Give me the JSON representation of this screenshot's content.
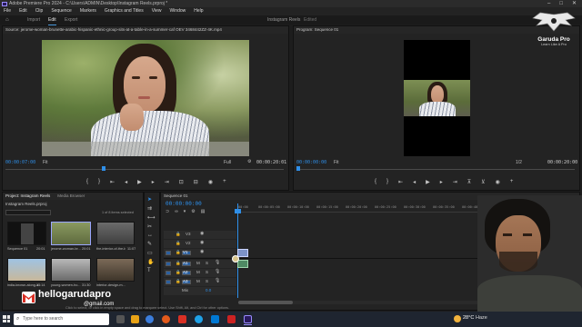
{
  "app": {
    "title": "Adobe Premiere Pro 2024 - C:\\Users\\ADMIN\\Desktop\\Instagram Reels.prproj *",
    "menu": [
      "File",
      "Edit",
      "Clip",
      "Sequence",
      "Markers",
      "Graphics and Titles",
      "View",
      "Window",
      "Help"
    ],
    "workspace_tabs": [
      "Import",
      "Edit",
      "Export"
    ],
    "project_name": "Instagram Reels",
    "edited_badge": "Edited"
  },
  "source_monitor": {
    "header": "Source: jerome-woman-brunette-arabic-hispanic-ethnic-group-sits-at-a-table-in-a-summer-caf OEV 3468442ZZ-4K.mp4",
    "timecode": "00:00:07:00",
    "fit": "Fit",
    "quality": "Full",
    "duration": "00:00:20:01"
  },
  "program_monitor": {
    "header": "Program: Sequence 01",
    "timecode": "00:00:00:00",
    "fit": "Fit",
    "quality": "1/2",
    "duration": "00:00:20:00"
  },
  "project_panel": {
    "tabs": [
      "Project: Instagram Reels",
      "Media Browser"
    ],
    "file": "Instagram Reels.prproj",
    "selection": "1 of 8 items selected",
    "items": [
      {
        "label": "Sequence 01",
        "dur": "20:01"
      },
      {
        "label": "jerome-woman-br...",
        "dur": "20:01"
      },
      {
        "label": "the-interior-of-the-bar...",
        "dur": "11:07"
      },
      {
        "label": "india-known-along-a...",
        "dur": "15:14"
      },
      {
        "label": "young-women-ho...",
        "dur": "31:30"
      },
      {
        "label": "interior-design-m...",
        "dur": ""
      }
    ]
  },
  "timeline": {
    "tab": "Sequence 01",
    "timecode": "00:00:00:00",
    "ruler": [
      "00:00",
      "00:00:05:00",
      "00:00:10:00",
      "00:00:15:00",
      "00:00:20:00",
      "00:00:25:00",
      "00:00:30:00",
      "00:00:35:00",
      "00:00:40:00",
      "00:00:45:00"
    ],
    "video_tracks": [
      "V3",
      "V2",
      "V1"
    ],
    "audio_tracks": [
      "A1",
      "A2",
      "A3"
    ],
    "mix_label": "Mix",
    "mix_value": "0.0"
  },
  "status_bar": "Click to select, or click in empty space and drag to marquee select. Use Shift, Alt, and Ctrl for other options.",
  "watermark": {
    "brand": "Garuda Pro",
    "tagline": "Learn Like A Pro",
    "email_handle": "hellogarudapro",
    "email_domain": "@gmail.com"
  },
  "taskbar": {
    "search_placeholder": "Type here to search",
    "weather_temp": "28°C",
    "weather_desc": "Haze",
    "colors": {
      "taskbar": "#1f2530",
      "accent": "#2f8fe8"
    }
  }
}
